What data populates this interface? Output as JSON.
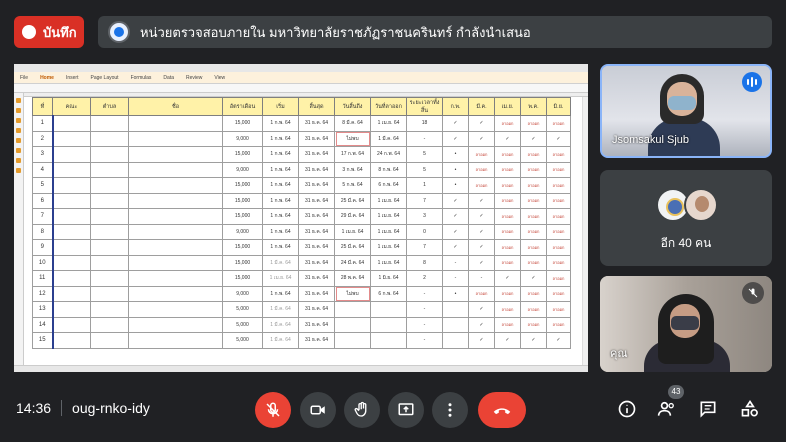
{
  "meeting": {
    "record_label": "บันทึก",
    "presenter_banner": "หน่วยตรวจสอบภายใน มหาวิทยาลัยราชภัฏราชนครินทร์ กำลังนำเสนอ",
    "time": "14:36",
    "code": "oug-rnko-idy",
    "participants_count": "43"
  },
  "excel": {
    "ribbon_tabs": [
      "File",
      "Home",
      "Insert",
      "Page Layout",
      "Formulas",
      "Data",
      "Review",
      "View"
    ],
    "headers": [
      "ที่",
      "คณะ",
      "ตำบล",
      "ชื่อ",
      "อัตราเดือน",
      "เริ่ม",
      "สิ้นสุด",
      "วันสิ้นถึง",
      "วันที่ลาออก",
      "ระยะเวลาทั้งสิ้น",
      "ก.พ.",
      "มี.ค.",
      "เม.ย.",
      "พ.ค.",
      "มิ.ย."
    ],
    "rows": [
      [
        "1",
        "15,000",
        "1 ก.พ. 64",
        "31 ธ.ค. 64",
        "8 มี.ค. 64",
        "1 เม.ย. 64",
        "18",
        "✓",
        "✓",
        "ลาออก",
        "ลาออก",
        "ลาออก"
      ],
      [
        "2",
        "9,000",
        "1 ก.พ. 64",
        "31 ธ.ค. 64",
        "ไม่พบ",
        "1 มี.ค. 64",
        "-",
        "✓",
        "✓",
        "✓",
        "✓",
        "✓"
      ],
      [
        "3",
        "15,000",
        "1 ก.พ. 64",
        "31 ธ.ค. 64",
        "17 ก.พ. 64",
        "24 ก.พ. 64",
        "5",
        "•",
        "ลาออก",
        "ลาออก",
        "ลาออก",
        "ลาออก"
      ],
      [
        "4",
        "9,000",
        "1 ก.พ. 64",
        "31 ธ.ค. 64",
        "3 ก.พ. 64",
        "8 ก.พ. 64",
        "5",
        "•",
        "ลาออก",
        "ลาออก",
        "ลาออก",
        "ลาออก"
      ],
      [
        "5",
        "15,000",
        "1 ก.พ. 64",
        "31 ธ.ค. 64",
        "5 ก.พ. 64",
        "6 ก.พ. 64",
        "1",
        "•",
        "ลาออก",
        "ลาออก",
        "ลาออก",
        "ลาออก"
      ],
      [
        "6",
        "15,000",
        "1 ก.พ. 64",
        "31 ธ.ค. 64",
        "25 มี.ค. 64",
        "1 เม.ย. 64",
        "7",
        "✓",
        "✓",
        "ลาออก",
        "ลาออก",
        "ลาออก"
      ],
      [
        "7",
        "15,000",
        "1 ก.พ. 64",
        "31 ธ.ค. 64",
        "29 มี.ค. 64",
        "1 เม.ย. 64",
        "3",
        "✓",
        "✓",
        "ลาออก",
        "ลาออก",
        "ลาออก"
      ],
      [
        "8",
        "9,000",
        "1 ก.พ. 64",
        "31 ธ.ค. 64",
        "1 เม.ย. 64",
        "1 เม.ย. 64",
        "0",
        "✓",
        "✓",
        "ลาออก",
        "ลาออก",
        "ลาออก"
      ],
      [
        "9",
        "15,000",
        "1 ก.พ. 64",
        "31 ธ.ค. 64",
        "25 มี.ค. 64",
        "1 เม.ย. 64",
        "7",
        "✓",
        "✓",
        "ลาออก",
        "ลาออก",
        "ลาออก"
      ],
      [
        "10",
        "15,000",
        "1 มี.ค. 64",
        "31 ธ.ค. 64",
        "24 มี.ค. 64",
        "1 เม.ย. 64",
        "8",
        "-",
        "✓",
        "ลาออก",
        "ลาออก",
        "ลาออก"
      ],
      [
        "11",
        "15,000",
        "1 เม.ย. 64",
        "31 ธ.ค. 64",
        "28 พ.ค. 64",
        "1 มิ.ย. 64",
        "2",
        "-",
        "-",
        "✓",
        "✓",
        "ลาออก"
      ],
      [
        "12",
        "9,000",
        "1 ก.พ. 64",
        "31 ธ.ค. 64",
        "ไม่พบ",
        "6 ก.พ. 64",
        "-",
        "•",
        "ลาออก",
        "ลาออก",
        "ลาออก",
        "ลาออก"
      ],
      [
        "13",
        "5,000",
        "1 มี.ค. 64",
        "31 ธ.ค. 64",
        "",
        "",
        "-",
        "",
        "✓",
        "ลาออก",
        "ลาออก",
        "ลาออก"
      ],
      [
        "14",
        "5,000",
        "1 มี.ค. 64",
        "31 ธ.ค. 64",
        "",
        "",
        "-",
        "",
        "✓",
        "ลาออก",
        "ลาออก",
        "ลาออก"
      ],
      [
        "15",
        "5,000",
        "1 มี.ค. 64",
        "31 ธ.ค. 64",
        "",
        "",
        "-",
        "",
        "✓",
        "✓",
        "✓",
        "✓"
      ],
      [
        "16",
        "5,000",
        "1 มี.ค. 64",
        "31 ธ.ค. 64",
        "",
        "",
        "-",
        "",
        "✓",
        "ลาออก",
        "ลาออก",
        "ลาออก"
      ]
    ]
  },
  "participants": {
    "tile1_name": "Jsomsakul Sjub",
    "more_label": "อีก 40 คน",
    "self_label": "คุณ"
  },
  "colors": {
    "background": "#202124",
    "record_red": "#d93025",
    "hangup_red": "#ea4335",
    "active_speaker_border": "#8ab4f8",
    "sheet_header": "#fff2a8"
  },
  "icons": [
    "record-dot-icon",
    "university-logo-icon",
    "audio-level-icon",
    "mic-off-icon",
    "camera-icon",
    "raise-hand-icon",
    "present-screen-icon",
    "more-options-icon",
    "hangup-icon",
    "info-icon",
    "people-icon",
    "chat-icon",
    "activities-icon"
  ]
}
